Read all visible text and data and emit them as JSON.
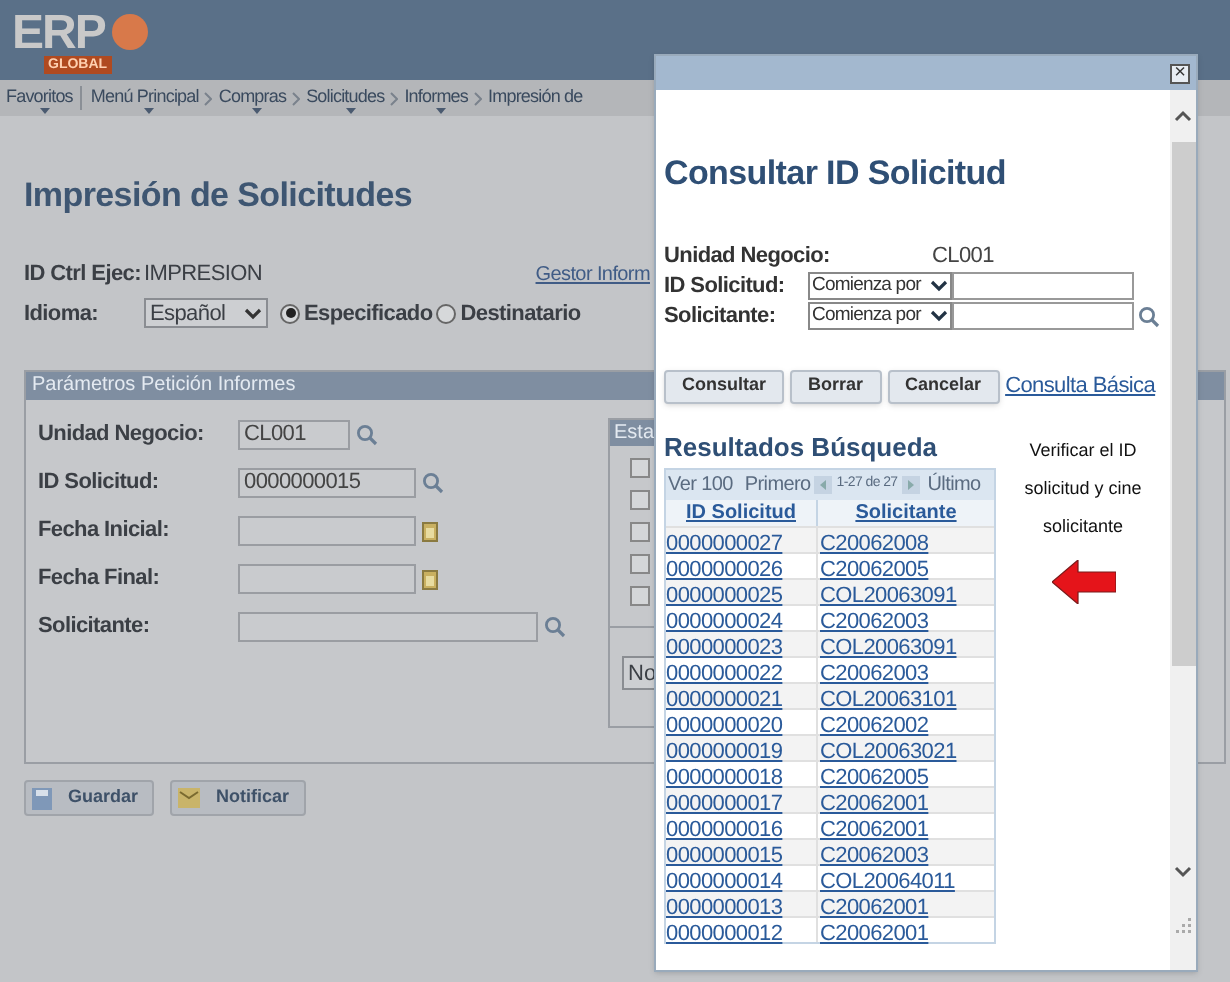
{
  "header": {
    "logo": "ERP",
    "logo_sub": "GLOBAL"
  },
  "breadcrumb": [
    {
      "label": "Favoritos",
      "menu": true
    },
    {
      "label": "Menú Principal",
      "menu": true
    },
    {
      "label": "Compras",
      "menu": true
    },
    {
      "label": "Solicitudes",
      "menu": true
    },
    {
      "label": "Informes",
      "menu": true
    },
    {
      "label": "Impresión de",
      "menu": false
    }
  ],
  "page": {
    "title": "Impresión de Solicitudes",
    "ctrl_label": "ID Ctrl Ejec:",
    "ctrl_value": "IMPRESION",
    "manager_link": "Gestor Inform",
    "language_label": "Idioma:",
    "language": "Español",
    "radios": [
      {
        "label": "Especificado",
        "selected": true
      },
      {
        "label": "Destinatario",
        "selected": false
      }
    ]
  },
  "params": {
    "title": "Parámetros Petición Informes",
    "fields": [
      {
        "label": "Unidad Negocio:",
        "value": "CL001",
        "kind": "lookup"
      },
      {
        "label": "ID Solicitud:",
        "value": "0000000015",
        "kind": "lookup"
      },
      {
        "label": "Fecha Inicial:",
        "kind": "date"
      },
      {
        "label": "Fecha Final:",
        "kind": "date"
      },
      {
        "label": "Solicitante:",
        "kind": "lookup"
      }
    ],
    "status_panel": {
      "title": "Esta",
      "checkboxes": [
        {
          "checked": false
        },
        {
          "checked": false
        },
        {
          "checked": false
        },
        {
          "checked": false
        },
        {
          "checked": false
        }
      ],
      "select": "No"
    }
  },
  "buttons": [
    {
      "label": "Guardar",
      "kind": "save"
    },
    {
      "label": "Notificar",
      "kind": "notify"
    }
  ],
  "modal": {
    "close": "×",
    "title": "Consultar ID Solicitud",
    "criteria": [
      {
        "label": "Unidad Negocio:",
        "kind": "static",
        "value": "CL001"
      },
      {
        "label": "ID Solicitud:",
        "kind": "search",
        "operator": "Comienza por",
        "lookup": false
      },
      {
        "label": "Solicitante:",
        "kind": "search",
        "operator": "Comienza por",
        "lookup": true
      }
    ],
    "buttons": [
      "Consultar",
      "Borrar",
      "Cancelar"
    ],
    "basic_link": "Consulta Básica",
    "results_title": "Resultados Búsqueda",
    "pager": {
      "view": "Ver 100",
      "first": "Primero",
      "range": "1-27 de 27",
      "last": "Último"
    },
    "columns": [
      "ID Solicitud",
      "Solicitante"
    ],
    "rows": [
      [
        "0000000027",
        "C20062008"
      ],
      [
        "0000000026",
        "C20062005"
      ],
      [
        "0000000025",
        "COL20063091"
      ],
      [
        "0000000024",
        "C20062003"
      ],
      [
        "0000000023",
        "COL20063091"
      ],
      [
        "0000000022",
        "C20062003"
      ],
      [
        "0000000021",
        "COL20063101"
      ],
      [
        "0000000020",
        "C20062002"
      ],
      [
        "0000000019",
        "COL20063021"
      ],
      [
        "0000000018",
        "C20062005"
      ],
      [
        "0000000017",
        "C20062001"
      ],
      [
        "0000000016",
        "C20062001"
      ],
      [
        "0000000015",
        "C20062003"
      ],
      [
        "0000000014",
        "COL20064011"
      ],
      [
        "0000000013",
        "C20062001"
      ],
      [
        "0000000012",
        "C20062001"
      ]
    ],
    "note": "Verificar el ID solicitud y cine solicitante"
  }
}
